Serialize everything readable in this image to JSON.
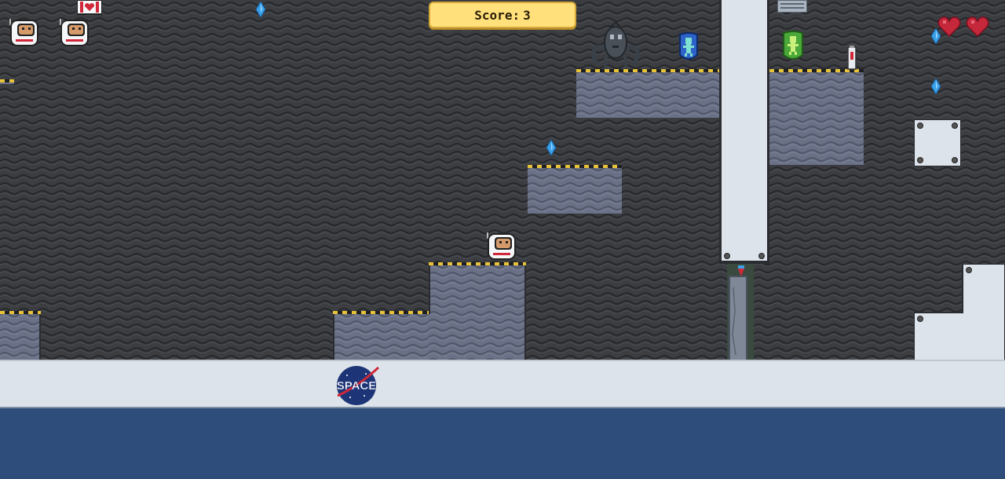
{
  "hud": {
    "score_label": "Score:",
    "score_value": "3",
    "lives": 2,
    "health": 2
  },
  "floor": {
    "logo_text": "SPACE"
  },
  "entities": [
    {
      "name": "player-astronaut",
      "kind": "player"
    },
    {
      "name": "alien-creature",
      "kind": "enemy"
    },
    {
      "name": "blue-alien-badge",
      "kind": "pickup"
    },
    {
      "name": "green-alien-badge",
      "kind": "pickup"
    },
    {
      "name": "crystal",
      "kind": "pickup"
    }
  ],
  "colors": {
    "background": "#3b3d41",
    "platform": "#6a7186",
    "hazard_yellow": "#e8c23a",
    "floor": "#dde3ea",
    "score_box": "#ffe07a",
    "heart": "#d0283a",
    "crystal": "#3aa0e8"
  }
}
